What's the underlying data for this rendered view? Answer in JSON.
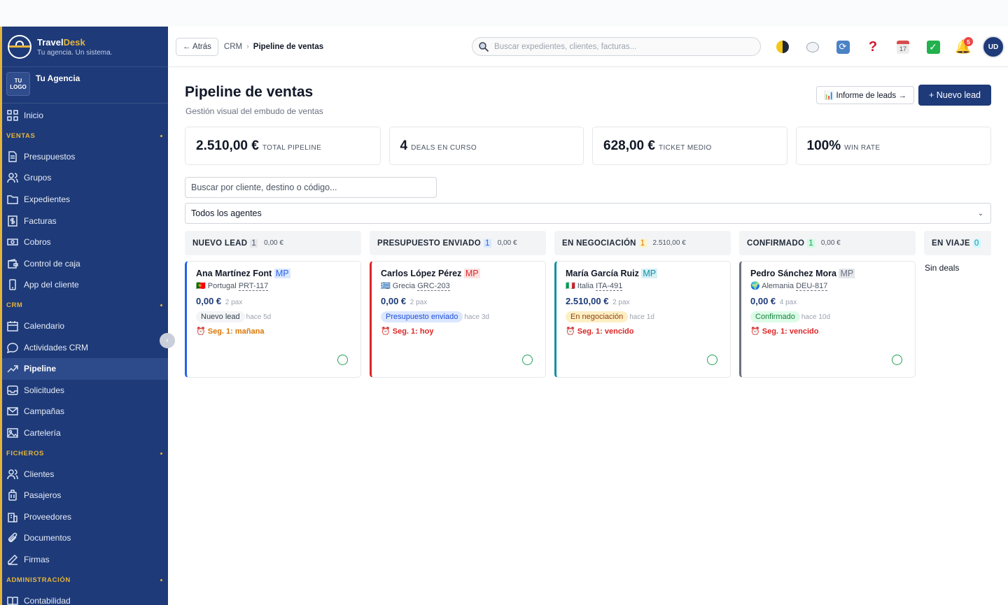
{
  "brand": {
    "name_a": "Travel",
    "name_b": "Desk",
    "tagline": "Tu agencia. Un sistema."
  },
  "agency": {
    "logo_text": "TU\nLOGO",
    "name": "Tu Agencia"
  },
  "sidebar": {
    "home": "Inicio",
    "sections": [
      {
        "title": "VENTAS",
        "items": [
          "Presupuestos",
          "Grupos",
          "Expedientes",
          "Facturas",
          "Cobros",
          "Control de caja",
          "App del cliente"
        ]
      },
      {
        "title": "CRM",
        "items": [
          "Calendario",
          "Actividades CRM",
          "Pipeline",
          "Solicitudes",
          "Campañas",
          "Cartelería"
        ]
      },
      {
        "title": "FICHEROS",
        "items": [
          "Clientes",
          "Pasajeros",
          "Proveedores",
          "Documentos",
          "Firmas"
        ]
      },
      {
        "title": "ADMINISTRACIÓN",
        "items": [
          "Contabilidad"
        ]
      }
    ],
    "active": "Pipeline"
  },
  "header": {
    "back_label": "← Atrás",
    "breadcrumb_parent": "CRM",
    "breadcrumb_current": "Pipeline de ventas",
    "search_placeholder": "Buscar expedientes, clientes, facturas...",
    "notifications_count": "5",
    "avatar_initials": "UD",
    "calendar_day": "17"
  },
  "page": {
    "title": "Pipeline de ventas",
    "subtitle": "Gestión visual del embudo de ventas",
    "report_button": "📊 Informe de leads →",
    "new_button": "+ Nuevo lead"
  },
  "stats": [
    {
      "value": "2.510,00 €",
      "label": "TOTAL PIPELINE"
    },
    {
      "value": "4",
      "label": "DEALS EN CURSO"
    },
    {
      "value": "628,00 €",
      "label": "TICKET MEDIO"
    },
    {
      "value": "100%",
      "label": "WIN RATE"
    }
  ],
  "filters": {
    "search_placeholder": "Buscar por cliente, destino o código...",
    "agents_selected": "Todos los agentes"
  },
  "columns": [
    {
      "title": "NUEVO LEAD",
      "count": "1",
      "amount": "0,00 €",
      "color": "#2563eb",
      "count_bg": "#e5e7eb",
      "count_fg": "#4b5563",
      "card": {
        "name": "Ana Martínez Font",
        "initials": "MP",
        "initials_bg": "#dbe7ff",
        "initials_fg": "#2563eb",
        "flag": "🇵🇹",
        "country": "Portugal",
        "code": "PRT-117",
        "price": "0,00 €",
        "pax": "2 pax",
        "stage": "Nuevo lead",
        "stage_bg": "#f3f4f6",
        "stage_fg": "#374151",
        "ago": "hace 5d",
        "followup": "⏰ Seg. 1: mañana",
        "follow_color": "#d97706"
      }
    },
    {
      "title": "PRESUPUESTO ENVIADO",
      "count": "1",
      "amount": "0,00 €",
      "color": "#dc2626",
      "count_bg": "#dbe7ff",
      "count_fg": "#2563eb",
      "card": {
        "name": "Carlos López Pérez",
        "initials": "MP",
        "initials_bg": "#fde2e2",
        "initials_fg": "#dc2626",
        "flag": "🇬🇷",
        "country": "Grecia",
        "code": "GRC-203",
        "price": "0,00 €",
        "pax": "2 pax",
        "stage": "Presupuesto enviado",
        "stage_bg": "#dbe7ff",
        "stage_fg": "#1d4ed8",
        "ago": "hace 3d",
        "followup": "⏰ Seg. 1: hoy",
        "follow_color": "#dc2626"
      }
    },
    {
      "title": "EN NEGOCIACIÓN",
      "count": "1",
      "amount": "2.510,00 €",
      "color": "#0e8fa5",
      "count_bg": "#fef3c7",
      "count_fg": "#d97706",
      "card": {
        "name": "María García Ruiz",
        "initials": "MP",
        "initials_bg": "#d6f1f6",
        "initials_fg": "#0e8fa5",
        "flag": "🇮🇹",
        "country": "Italia",
        "code": "ITA-491",
        "price": "2.510,00 €",
        "pax": "2 pax",
        "stage": "En negociación",
        "stage_bg": "#fdefc4",
        "stage_fg": "#92400e",
        "ago": "hace 1d",
        "followup": "⏰ Seg. 1: vencido",
        "follow_color": "#dc2626"
      }
    },
    {
      "title": "CONFIRMADO",
      "count": "1",
      "amount": "0,00 €",
      "color": "#6b7280",
      "count_bg": "#d1fae5",
      "count_fg": "#16a34a",
      "card": {
        "name": "Pedro Sánchez Mora",
        "initials": "MP",
        "initials_bg": "#e5e7eb",
        "initials_fg": "#6b7280",
        "flag": "🌍",
        "country": "Alemania",
        "code": "DEU-817",
        "price": "0,00 €",
        "pax": "4 pax",
        "stage": "Confirmado",
        "stage_bg": "#dcfce7",
        "stage_fg": "#15803d",
        "ago": "hace 10d",
        "followup": "⏰ Seg. 1: vencido",
        "follow_color": "#dc2626"
      }
    },
    {
      "title": "EN VIAJE",
      "count": "0",
      "amount": "",
      "color": "#0e8fa5",
      "count_bg": "#cffafe",
      "count_fg": "#0891b2",
      "empty_text": "Sin deals"
    }
  ]
}
